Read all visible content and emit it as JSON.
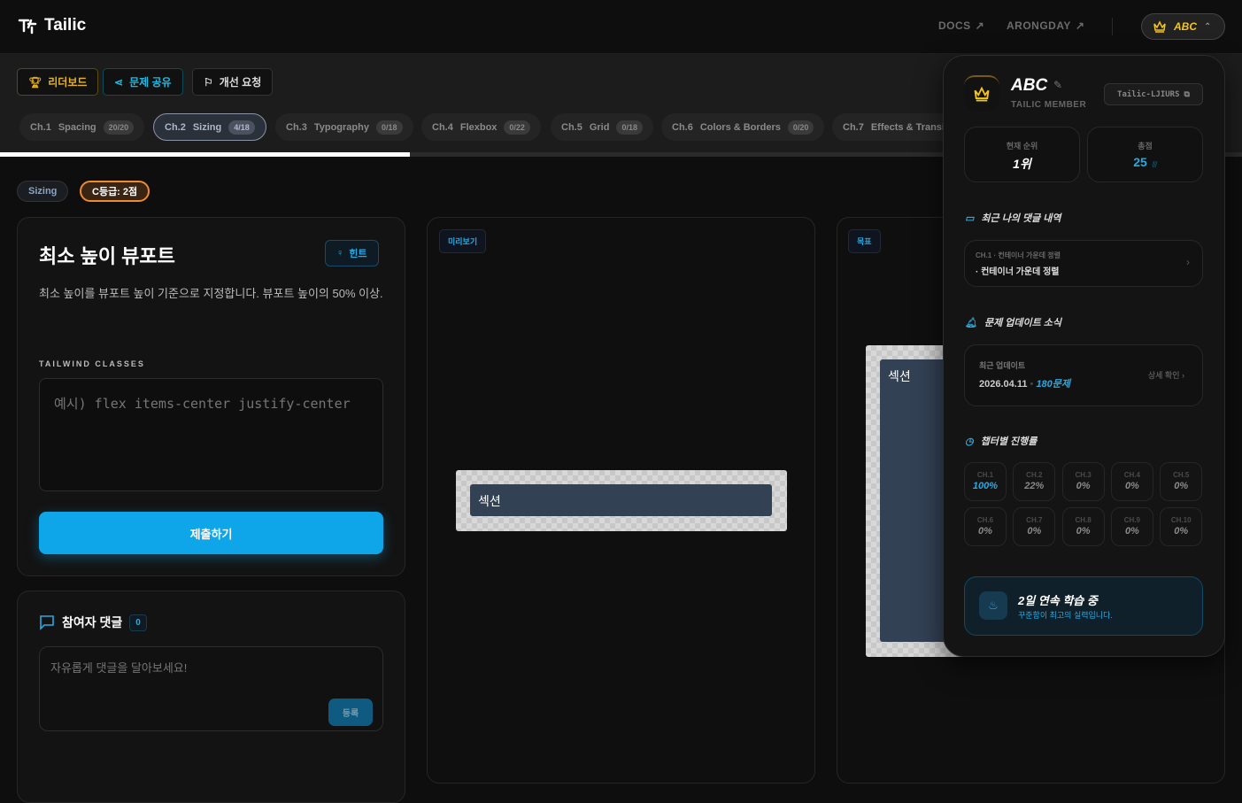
{
  "header": {
    "logo": "Tailic",
    "links": [
      {
        "label": "DOCS"
      },
      {
        "label": "ARONGDAY"
      }
    ],
    "user": "ABC"
  },
  "toolbar": {
    "leaderboard": "리더보드",
    "share": "문제 공유",
    "feedback": "개선 요청"
  },
  "chapters": [
    {
      "num": "Ch.1",
      "name": "Spacing",
      "count": "20/20"
    },
    {
      "num": "Ch.2",
      "name": "Sizing",
      "count": "4/18",
      "active": true
    },
    {
      "num": "Ch.3",
      "name": "Typography",
      "count": "0/18"
    },
    {
      "num": "Ch.4",
      "name": "Flexbox",
      "count": "0/22"
    },
    {
      "num": "Ch.5",
      "name": "Grid",
      "count": "0/18"
    },
    {
      "num": "Ch.6",
      "name": "Colors & Borders",
      "count": "0/20"
    },
    {
      "num": "Ch.7",
      "name": "Effects & Transitions",
      "count": ""
    }
  ],
  "progress_percent": 33,
  "tags": {
    "category": "Sizing",
    "grade": "C등급: 2점"
  },
  "problem": {
    "title": "최소 높이 뷰포트",
    "hint": "힌트",
    "description": "최소 높이를 뷰포트 높이 기준으로 지정합니다. 뷰포트 높이의 50% 이상.",
    "classes_label": "TAILWIND CLASSES",
    "input_placeholder": "예시) flex items-center justify-center",
    "submit": "제출하기"
  },
  "comments": {
    "title": "참여자 댓글",
    "count": "0",
    "placeholder": "자유롭게 댓글을 달아보세요!",
    "submit": "등록"
  },
  "preview": {
    "label": "미리보기",
    "section": "섹션"
  },
  "target": {
    "label": "목표",
    "section": "섹션"
  },
  "panel": {
    "name": "ABC",
    "role": "TAILIC MEMBER",
    "code": "Tailic-LJIURS",
    "rank_label": "현재 순위",
    "rank": "1위",
    "score_label": "총점",
    "score": "25",
    "score_unit": "점",
    "comments_title": "최근 나의 댓글 내역",
    "comment_meta": "CH.1 · 컨테이너 가운데 정렬",
    "comment_text": "· 컨테이너 가운데 정렬",
    "updates_title": "문제 업데이트 소식",
    "update_label": "최근 업데이트",
    "update_date": "2026.04.11",
    "update_count": "180문제",
    "update_detail": "상세 확인",
    "progress_title": "챕터별 진행률",
    "chapter_progress": [
      {
        "ch": "CH.1",
        "v": "100%"
      },
      {
        "ch": "CH.2",
        "v": "22%"
      },
      {
        "ch": "CH.3",
        "v": "0%"
      },
      {
        "ch": "CH.4",
        "v": "0%"
      },
      {
        "ch": "CH.5",
        "v": "0%"
      },
      {
        "ch": "CH.6",
        "v": "0%"
      },
      {
        "ch": "CH.7",
        "v": "0%"
      },
      {
        "ch": "CH.8",
        "v": "0%"
      },
      {
        "ch": "CH.9",
        "v": "0%"
      },
      {
        "ch": "CH.10",
        "v": "0%"
      }
    ],
    "streak_title": "2일 연속 학습 중",
    "streak_sub": "꾸준함이 최고의 실력입니다."
  },
  "colors": {
    "accent": "#0ea5e9",
    "gold": "#f5c518",
    "grade": "#f08a2c"
  }
}
